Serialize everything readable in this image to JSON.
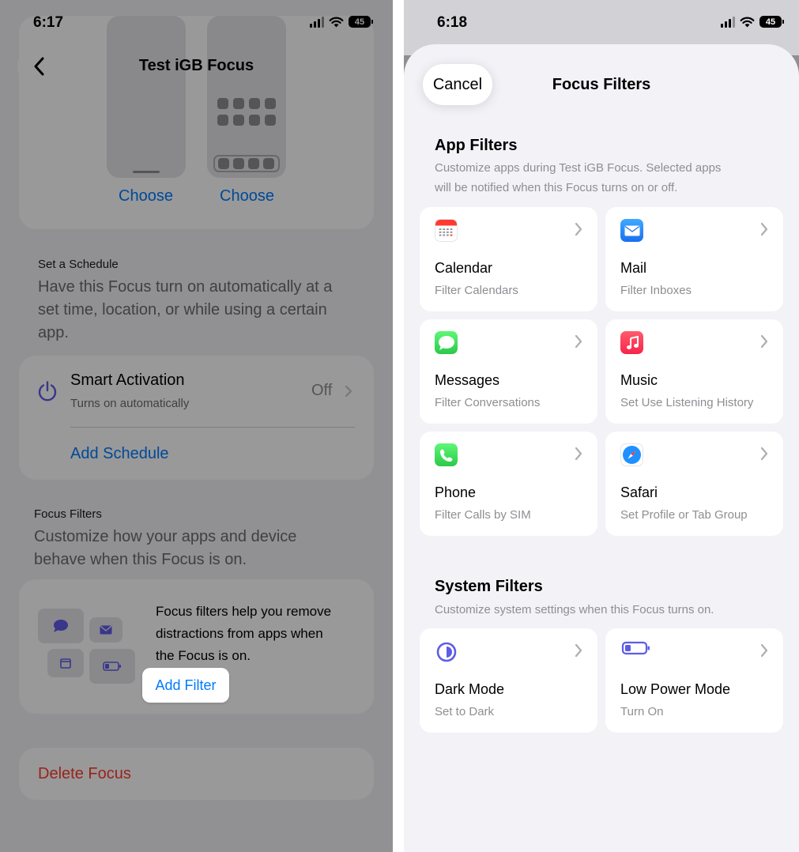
{
  "left": {
    "status": {
      "time": "6:17",
      "battery": "45"
    },
    "title": "Test iGB Focus",
    "preview": {
      "choose_lock": "Choose",
      "choose_home": "Choose"
    },
    "schedule": {
      "heading": "Set a Schedule",
      "description_line1": "Have this Focus turn on automatically at a",
      "description_line2": "set time, location, or while using a certain",
      "description_line3": "app.",
      "smart_activation": {
        "title": "Smart Activation",
        "subtitle": "Turns on automatically",
        "value": "Off"
      },
      "add_schedule": "Add Schedule"
    },
    "filters": {
      "heading": "Focus Filters",
      "description_line1": "Customize how your apps and device",
      "description_line2": "behave when this Focus is on.",
      "card_text_line1": "Focus filters help you remove",
      "card_text_line2": "distractions from apps when",
      "card_text_line3": "the Focus is on.",
      "add_filter": "Add Filter"
    },
    "delete": "Delete Focus"
  },
  "right": {
    "status": {
      "time": "6:18",
      "battery": "45"
    },
    "cancel": "Cancel",
    "title": "Focus Filters",
    "app_filters": {
      "title": "App Filters",
      "description_line1": "Customize apps during Test iGB Focus. Selected apps",
      "description_line2": "will be notified when this Focus turns on or off.",
      "items": [
        {
          "name": "Calendar",
          "subtitle": "Filter Calendars",
          "icon": "calendar-icon"
        },
        {
          "name": "Mail",
          "subtitle": "Filter Inboxes",
          "icon": "mail-icon"
        },
        {
          "name": "Messages",
          "subtitle": "Filter Conversations",
          "icon": "messages-icon"
        },
        {
          "name": "Music",
          "subtitle": "Set Use Listening History",
          "icon": "music-icon"
        },
        {
          "name": "Phone",
          "subtitle": "Filter Calls by SIM",
          "icon": "phone-icon"
        },
        {
          "name": "Safari",
          "subtitle": "Set Profile or Tab Group",
          "icon": "safari-icon"
        }
      ]
    },
    "system_filters": {
      "title": "System Filters",
      "description": "Customize system settings when this Focus turns on.",
      "items": [
        {
          "name": "Dark Mode",
          "subtitle": "Set to Dark",
          "icon": "dark-mode-icon"
        },
        {
          "name": "Low Power Mode",
          "subtitle": "Turn On",
          "icon": "battery-icon"
        }
      ]
    }
  },
  "colors": {
    "accent": "#007aff",
    "destructive": "#ff3b30",
    "focus_purple": "#5e5ce6",
    "background": "#f2f2f7"
  }
}
